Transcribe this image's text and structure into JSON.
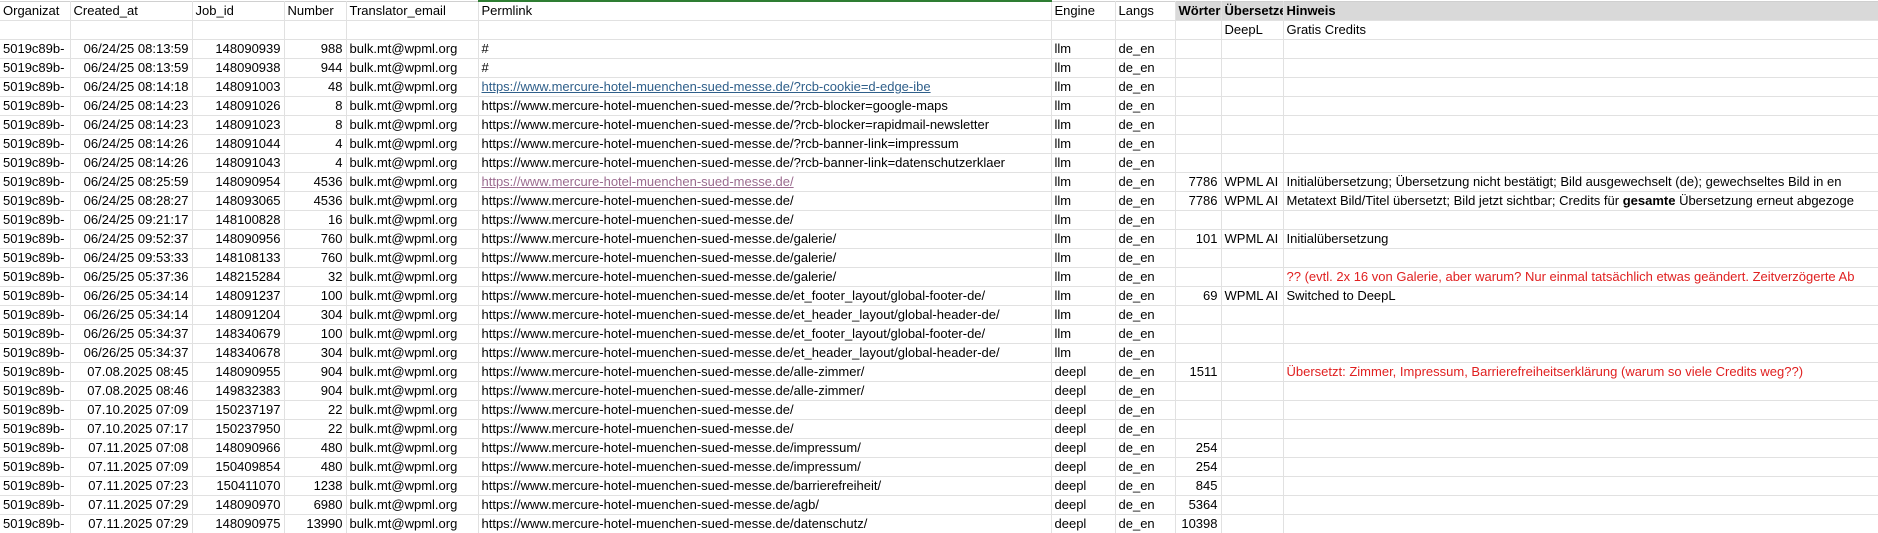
{
  "headers": [
    "Organizat",
    "Created_at",
    "Job_id",
    "Number",
    "Translator_email",
    "Permlink",
    "Engine",
    "Langs",
    "Wörter",
    "Übersetze",
    "Hinweis"
  ],
  "sub_headers": {
    "translator": "DeepL",
    "hint": "Gratis Credits"
  },
  "rows": [
    {
      "org": "5019c89b-",
      "created": "06/24/25 08:13:59",
      "job": "148090939",
      "number": "988",
      "email": "bulk.mt@wpml.org",
      "perm": "#",
      "engine": "llm",
      "langs": "de_en",
      "words": "",
      "trans": "",
      "hint": ""
    },
    {
      "org": "5019c89b-",
      "created": "06/24/25 08:13:59",
      "job": "148090938",
      "number": "944",
      "email": "bulk.mt@wpml.org",
      "perm": "#",
      "engine": "llm",
      "langs": "de_en",
      "words": "",
      "trans": "",
      "hint": ""
    },
    {
      "org": "5019c89b-",
      "created": "06/24/25 08:14:18",
      "job": "148091003",
      "number": "48",
      "email": "bulk.mt@wpml.org",
      "perm": "https://www.mercure-hotel-muenchen-sued-messe.de/?rcb-cookie=d-edge-ibe",
      "engine": "llm",
      "langs": "de_en",
      "words": "",
      "trans": "",
      "hint": ""
    },
    {
      "org": "5019c89b-",
      "created": "06/24/25 08:14:23",
      "job": "148091026",
      "number": "8",
      "email": "bulk.mt@wpml.org",
      "perm": "https://www.mercure-hotel-muenchen-sued-messe.de/?rcb-blocker=google-maps",
      "engine": "llm",
      "langs": "de_en",
      "words": "",
      "trans": "",
      "hint": ""
    },
    {
      "org": "5019c89b-",
      "created": "06/24/25 08:14:23",
      "job": "148091023",
      "number": "8",
      "email": "bulk.mt@wpml.org",
      "perm": "https://www.mercure-hotel-muenchen-sued-messe.de/?rcb-blocker=rapidmail-newsletter",
      "engine": "llm",
      "langs": "de_en",
      "words": "",
      "trans": "",
      "hint": ""
    },
    {
      "org": "5019c89b-",
      "created": "06/24/25 08:14:26",
      "job": "148091044",
      "number": "4",
      "email": "bulk.mt@wpml.org",
      "perm": "https://www.mercure-hotel-muenchen-sued-messe.de/?rcb-banner-link=impressum",
      "engine": "llm",
      "langs": "de_en",
      "words": "",
      "trans": "",
      "hint": ""
    },
    {
      "org": "5019c89b-",
      "created": "06/24/25 08:14:26",
      "job": "148091043",
      "number": "4",
      "email": "bulk.mt@wpml.org",
      "perm": "https://www.mercure-hotel-muenchen-sued-messe.de/?rcb-banner-link=datenschutzerklaer",
      "engine": "llm",
      "langs": "de_en",
      "words": "",
      "trans": "",
      "hint": ""
    },
    {
      "org": "5019c89b-",
      "created": "06/24/25 08:25:59",
      "job": "148090954",
      "number": "4536",
      "email": "bulk.mt@wpml.org",
      "perm": "https://www.mercure-hotel-muenchen-sued-messe.de/",
      "engine": "llm",
      "langs": "de_en",
      "words": "7786",
      "trans": "WPML AI",
      "hint": "Initialübersetzung; Übersetzung nicht bestätigt; Bild ausgewechselt (de); gewechseltes Bild in en"
    },
    {
      "org": "5019c89b-",
      "created": "06/24/25 08:28:27",
      "job": "148093065",
      "number": "4536",
      "email": "bulk.mt@wpml.org",
      "perm": "https://www.mercure-hotel-muenchen-sued-messe.de/",
      "engine": "llm",
      "langs": "de_en",
      "words": "7786",
      "trans": "WPML AI",
      "hint": "Metatext Bild/Titel übersetzt; Bild jetzt sichtbar; Credits für gesamte Übersetzung erneut abgezoge"
    },
    {
      "org": "5019c89b-",
      "created": "06/24/25 09:21:17",
      "job": "148100828",
      "number": "16",
      "email": "bulk.mt@wpml.org",
      "perm": "https://www.mercure-hotel-muenchen-sued-messe.de/",
      "engine": "llm",
      "langs": "de_en",
      "words": "",
      "trans": "",
      "hint": ""
    },
    {
      "org": "5019c89b-",
      "created": "06/24/25 09:52:37",
      "job": "148090956",
      "number": "760",
      "email": "bulk.mt@wpml.org",
      "perm": "https://www.mercure-hotel-muenchen-sued-messe.de/galerie/",
      "engine": "llm",
      "langs": "de_en",
      "words": "101",
      "trans": "WPML AI",
      "hint": "Initialübersetzung"
    },
    {
      "org": "5019c89b-",
      "created": "06/24/25 09:53:33",
      "job": "148108133",
      "number": "760",
      "email": "bulk.mt@wpml.org",
      "perm": "https://www.mercure-hotel-muenchen-sued-messe.de/galerie/",
      "engine": "llm",
      "langs": "de_en",
      "words": "",
      "trans": "",
      "hint": ""
    },
    {
      "org": "5019c89b-",
      "created": "06/25/25 05:37:36",
      "job": "148215284",
      "number": "32",
      "email": "bulk.mt@wpml.org",
      "perm": "https://www.mercure-hotel-muenchen-sued-messe.de/galerie/",
      "engine": "llm",
      "langs": "de_en",
      "words": "",
      "trans": "",
      "hint": "?? (evtl. 2x 16 von Galerie, aber warum? Nur einmal tatsächlich etwas geändert. Zeitverzögerte Ab"
    },
    {
      "org": "5019c89b-",
      "created": "06/26/25 05:34:14",
      "job": "148091237",
      "number": "100",
      "email": "bulk.mt@wpml.org",
      "perm": "https://www.mercure-hotel-muenchen-sued-messe.de/et_footer_layout/global-footer-de/",
      "engine": "llm",
      "langs": "de_en",
      "words": "69",
      "trans": "WPML AI",
      "hint": "Switched to DeepL"
    },
    {
      "org": "5019c89b-",
      "created": "06/26/25 05:34:14",
      "job": "148091204",
      "number": "304",
      "email": "bulk.mt@wpml.org",
      "perm": "https://www.mercure-hotel-muenchen-sued-messe.de/et_header_layout/global-header-de/",
      "engine": "llm",
      "langs": "de_en",
      "words": "",
      "trans": "",
      "hint": ""
    },
    {
      "org": "5019c89b-",
      "created": "06/26/25 05:34:37",
      "job": "148340679",
      "number": "100",
      "email": "bulk.mt@wpml.org",
      "perm": "https://www.mercure-hotel-muenchen-sued-messe.de/et_footer_layout/global-footer-de/",
      "engine": "llm",
      "langs": "de_en",
      "words": "",
      "trans": "",
      "hint": ""
    },
    {
      "org": "5019c89b-",
      "created": "06/26/25 05:34:37",
      "job": "148340678",
      "number": "304",
      "email": "bulk.mt@wpml.org",
      "perm": "https://www.mercure-hotel-muenchen-sued-messe.de/et_header_layout/global-header-de/",
      "engine": "llm",
      "langs": "de_en",
      "words": "",
      "trans": "",
      "hint": ""
    },
    {
      "org": "5019c89b-",
      "created": "07.08.2025 08:45",
      "job": "148090955",
      "number": "904",
      "email": "bulk.mt@wpml.org",
      "perm": "https://www.mercure-hotel-muenchen-sued-messe.de/alle-zimmer/",
      "engine": "deepl",
      "langs": "de_en",
      "words": "1511",
      "trans": "",
      "hint": "Übersetzt: Zimmer, Impressum, Barrierefreiheitserklärung (warum so viele Credits weg??)"
    },
    {
      "org": "5019c89b-",
      "created": "07.08.2025 08:46",
      "job": "149832383",
      "number": "904",
      "email": "bulk.mt@wpml.org",
      "perm": "https://www.mercure-hotel-muenchen-sued-messe.de/alle-zimmer/",
      "engine": "deepl",
      "langs": "de_en",
      "words": "",
      "trans": "",
      "hint": ""
    },
    {
      "org": "5019c89b-",
      "created": "07.10.2025 07:09",
      "job": "150237197",
      "number": "22",
      "email": "bulk.mt@wpml.org",
      "perm": "https://www.mercure-hotel-muenchen-sued-messe.de/",
      "engine": "deepl",
      "langs": "de_en",
      "words": "",
      "trans": "",
      "hint": ""
    },
    {
      "org": "5019c89b-",
      "created": "07.10.2025 07:17",
      "job": "150237950",
      "number": "22",
      "email": "bulk.mt@wpml.org",
      "perm": "https://www.mercure-hotel-muenchen-sued-messe.de/",
      "engine": "deepl",
      "langs": "de_en",
      "words": "",
      "trans": "",
      "hint": ""
    },
    {
      "org": "5019c89b-",
      "created": "07.11.2025 07:08",
      "job": "148090966",
      "number": "480",
      "email": "bulk.mt@wpml.org",
      "perm": "https://www.mercure-hotel-muenchen-sued-messe.de/impressum/",
      "engine": "deepl",
      "langs": "de_en",
      "words": "254",
      "trans": "",
      "hint": ""
    },
    {
      "org": "5019c89b-",
      "created": "07.11.2025 07:09",
      "job": "150409854",
      "number": "480",
      "email": "bulk.mt@wpml.org",
      "perm": "https://www.mercure-hotel-muenchen-sued-messe.de/impressum/",
      "engine": "deepl",
      "langs": "de_en",
      "words": "254",
      "trans": "",
      "hint": ""
    },
    {
      "org": "5019c89b-",
      "created": "07.11.2025 07:23",
      "job": "150411070",
      "number": "1238",
      "email": "bulk.mt@wpml.org",
      "perm": "https://www.mercure-hotel-muenchen-sued-messe.de/barrierefreiheit/",
      "engine": "deepl",
      "langs": "de_en",
      "words": "845",
      "trans": "",
      "hint": ""
    },
    {
      "org": "5019c89b-",
      "created": "07.11.2025 07:29",
      "job": "148090970",
      "number": "6980",
      "email": "bulk.mt@wpml.org",
      "perm": "https://www.mercure-hotel-muenchen-sued-messe.de/agb/",
      "engine": "deepl",
      "langs": "de_en",
      "words": "5364",
      "trans": "",
      "hint": ""
    },
    {
      "org": "5019c89b-",
      "created": "07.11.2025 07:29",
      "job": "148090975",
      "number": "13990",
      "email": "bulk.mt@wpml.org",
      "perm": "https://www.mercure-hotel-muenchen-sued-messe.de/datenschutz/",
      "engine": "deepl",
      "langs": "de_en",
      "words": "10398",
      "trans": "",
      "hint": ""
    }
  ]
}
